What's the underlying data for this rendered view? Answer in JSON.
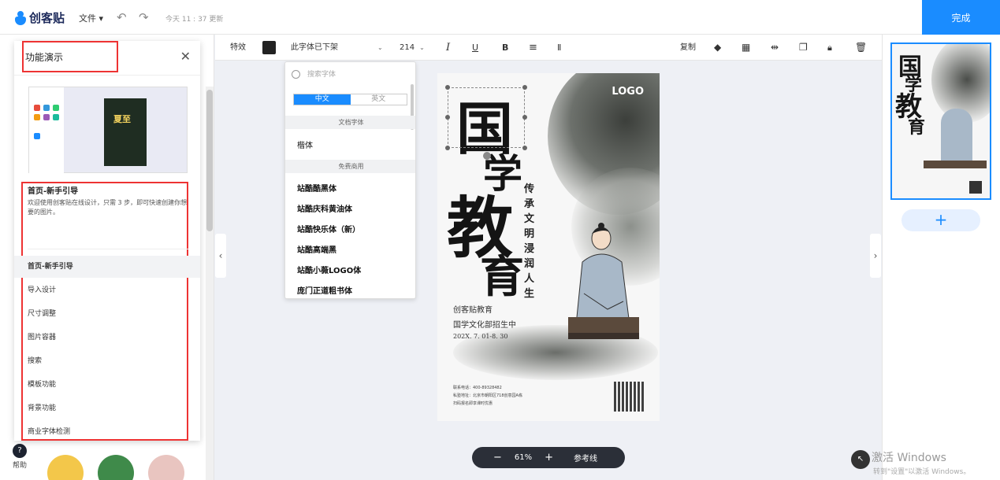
{
  "topbar": {
    "brand": "创客贴",
    "file_menu": "文件",
    "saved_text": "今天 11 : 37 更新",
    "done_label": "完成"
  },
  "guide": {
    "title": "功能演示",
    "preview_poster_text": "夏至",
    "heading": "首页-新手引导",
    "description": "欢迎使用创客贴在线设计，只需 3 步，即可快速创建你想要的图片。",
    "items": [
      {
        "label": "首页-新手引导",
        "active": true
      },
      {
        "label": "导入设计",
        "active": false
      },
      {
        "label": "尺寸调整",
        "active": false
      },
      {
        "label": "图片容器",
        "active": false
      },
      {
        "label": "搜索",
        "active": false
      },
      {
        "label": "模板功能",
        "active": false
      },
      {
        "label": "背景功能",
        "active": false
      },
      {
        "label": "商业字体检测",
        "active": false
      }
    ]
  },
  "left_panel": {
    "help_label": "帮助"
  },
  "toolbar": {
    "effects": "特效",
    "text_color": "#222222",
    "font_name": "此字体已下架",
    "font_size": "214",
    "italic": "I",
    "underline": "U",
    "bold": "B",
    "copy": "复制"
  },
  "font_panel": {
    "search_placeholder": "搜索字体",
    "tab_cn": "中文",
    "tab_en": "英文",
    "section_doc": "文档字体",
    "doc_fonts": [
      "楷体"
    ],
    "section_free": "免费商用",
    "free_fonts": [
      "站酷酷黑体",
      "站酷庆科黄油体",
      "站酷快乐体（新）",
      "站酷高端黑",
      "站酷小薇LOGO体",
      "庞门正道粗书体"
    ]
  },
  "poster": {
    "logo": "LOGO",
    "char1": "国",
    "char2": "学",
    "char3": "教",
    "char4": "育",
    "vertical_text": "传承文明浸润人生",
    "line1": "创客贴教育",
    "line2": "国学文化部招生中",
    "line3": "202X. 7. 01-8. 30",
    "contact1": "联系电话：400-89328482",
    "contact2": "私塾地址：北京市朝阳区718创意园A栋",
    "contact3": "扫码报名即享课时优惠"
  },
  "zoom": {
    "minus": "−",
    "value": "61%",
    "plus": "+",
    "guides": "参考线"
  },
  "pages": {
    "add": "+"
  },
  "activation": {
    "title": "激活 Windows",
    "subtitle": "转到\"设置\"以激活 Windows。"
  },
  "colors": {
    "accent": "#1a8cff",
    "highlight_box": "#e33333"
  }
}
